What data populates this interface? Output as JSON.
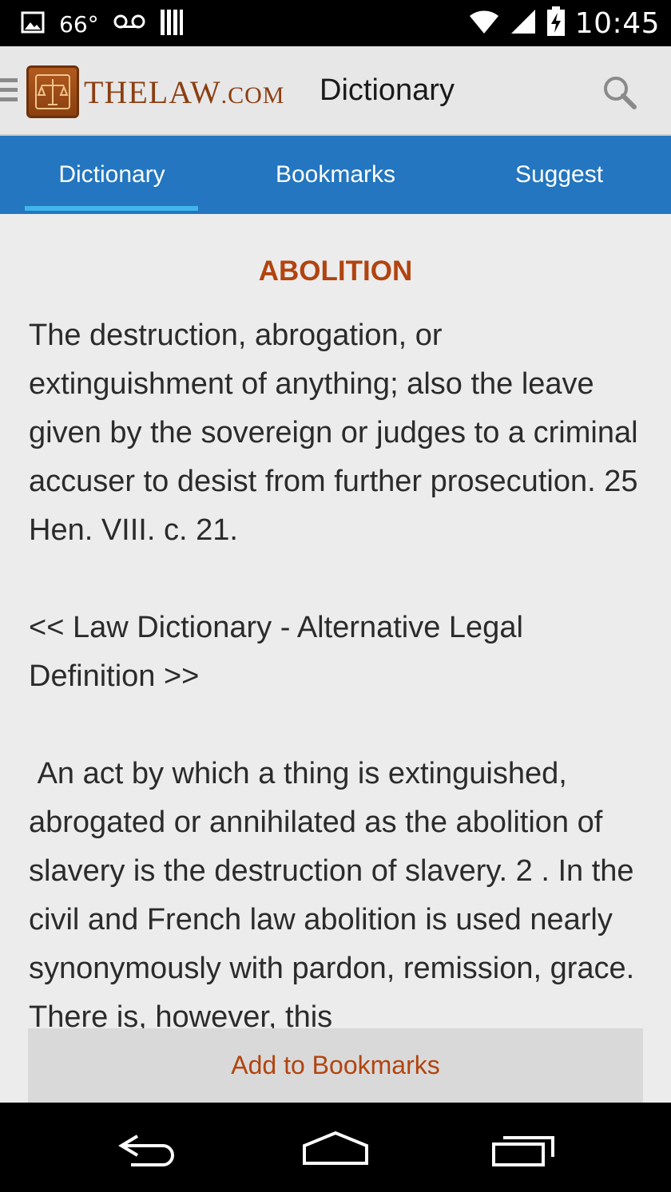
{
  "status_bar": {
    "temperature": "66°",
    "time": "10:45"
  },
  "action_bar": {
    "logo_main": "THELAW",
    "logo_suffix": ".COM",
    "title": "Dictionary"
  },
  "tabs": [
    {
      "label": "Dictionary",
      "selected": true
    },
    {
      "label": "Bookmarks",
      "selected": false
    },
    {
      "label": "Suggest",
      "selected": false
    }
  ],
  "entry": {
    "term": "ABOLITION",
    "definition_1": "The destruction, abrogation, or extinguishment of anything; also the leave given by the sovereign or judges to a criminal accuser to desist from further prosecution. 25 Hen. VIII. c. 21.",
    "alt_link": "<< Law Dictionary - Alternative Legal Definition >>",
    "definition_2": " An act by which a thing is extinguished, abrogated or annihilated as the abolition of slavery is the destruction of slavery. 2 . In the civil and French law abolition is used nearly synonymously with pardon, remission, grace. There is, however, this"
  },
  "bookmark_button": "Add to Bookmarks",
  "colors": {
    "accent": "#b1440f",
    "tab_bar": "#2376bf",
    "tab_indicator": "#41b5ea",
    "background": "#ececec"
  }
}
